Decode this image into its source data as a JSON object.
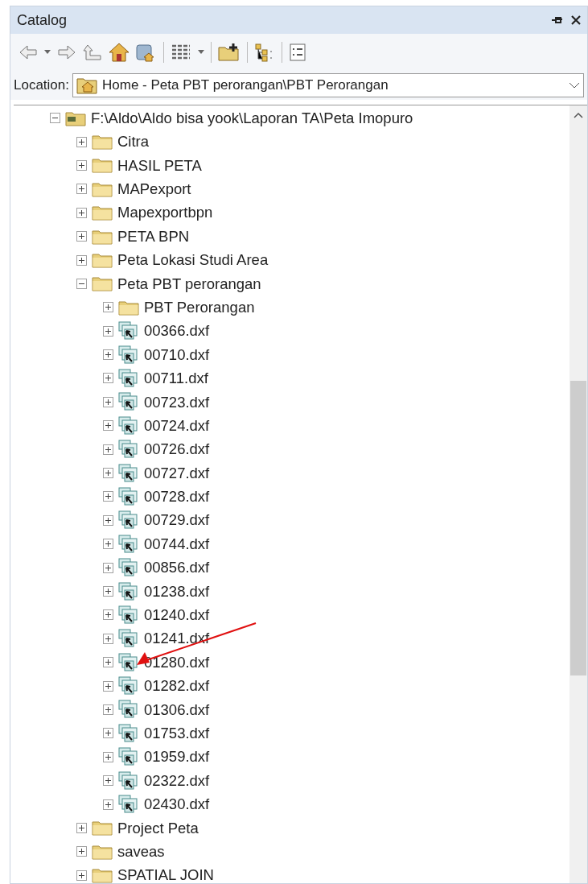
{
  "window": {
    "title": "Catalog"
  },
  "location": {
    "label": "Location:",
    "value": "Home - Peta PBT perorangan\\PBT Perorangan"
  },
  "tree": [
    {
      "label": "F:\\Aldo\\Aldo bisa yook\\Laporan TA\\Peta Imopuro",
      "kind": "drive-folder",
      "expanded": true,
      "children": [
        {
          "label": "Citra",
          "kind": "folder",
          "expanded": false
        },
        {
          "label": "HASIL PETA",
          "kind": "folder",
          "expanded": false
        },
        {
          "label": "MAPexport",
          "kind": "folder",
          "expanded": false
        },
        {
          "label": "Mapexportbpn",
          "kind": "folder",
          "expanded": false
        },
        {
          "label": "PETA BPN",
          "kind": "folder",
          "expanded": false
        },
        {
          "label": "Peta Lokasi Studi Area",
          "kind": "folder",
          "expanded": false
        },
        {
          "label": "Peta PBT perorangan",
          "kind": "folder",
          "expanded": true,
          "children": [
            {
              "label": "PBT Perorangan",
              "kind": "folder",
              "expanded": false
            },
            {
              "label": "00366.dxf",
              "kind": "cad",
              "expanded": false
            },
            {
              "label": "00710.dxf",
              "kind": "cad",
              "expanded": false
            },
            {
              "label": "00711.dxf",
              "kind": "cad",
              "expanded": false
            },
            {
              "label": "00723.dxf",
              "kind": "cad",
              "expanded": false
            },
            {
              "label": "00724.dxf",
              "kind": "cad",
              "expanded": false
            },
            {
              "label": "00726.dxf",
              "kind": "cad",
              "expanded": false
            },
            {
              "label": "00727.dxf",
              "kind": "cad",
              "expanded": false
            },
            {
              "label": "00728.dxf",
              "kind": "cad",
              "expanded": false
            },
            {
              "label": "00729.dxf",
              "kind": "cad",
              "expanded": false
            },
            {
              "label": "00744.dxf",
              "kind": "cad",
              "expanded": false
            },
            {
              "label": "00856.dxf",
              "kind": "cad",
              "expanded": false
            },
            {
              "label": "01238.dxf",
              "kind": "cad",
              "expanded": false
            },
            {
              "label": "01240.dxf",
              "kind": "cad",
              "expanded": false
            },
            {
              "label": "01241.dxf",
              "kind": "cad",
              "expanded": false
            },
            {
              "label": "01280.dxf",
              "kind": "cad",
              "expanded": false
            },
            {
              "label": "01282.dxf",
              "kind": "cad",
              "expanded": false
            },
            {
              "label": "01306.dxf",
              "kind": "cad",
              "expanded": false
            },
            {
              "label": "01753.dxf",
              "kind": "cad",
              "expanded": false
            },
            {
              "label": "01959.dxf",
              "kind": "cad",
              "expanded": false
            },
            {
              "label": "02322.dxf",
              "kind": "cad",
              "expanded": false
            },
            {
              "label": "02430.dxf",
              "kind": "cad",
              "expanded": false
            }
          ]
        },
        {
          "label": "Project Peta",
          "kind": "folder",
          "expanded": false
        },
        {
          "label": "saveas",
          "kind": "folder",
          "expanded": false
        },
        {
          "label": "SPATIAL JOIN",
          "kind": "folder",
          "expanded": false
        }
      ]
    }
  ]
}
